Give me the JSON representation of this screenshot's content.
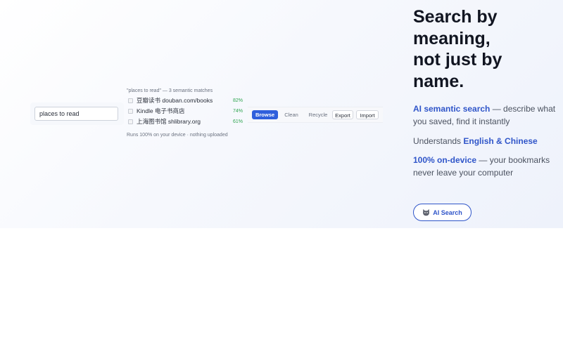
{
  "search": {
    "value": "places to read",
    "caption": "\"places to read\" — 3 semantic matches",
    "results": [
      {
        "label": "豆瓣读书 douban.com/books",
        "score": "82%"
      },
      {
        "label": "Kindle 电子书商店",
        "score": "74%"
      },
      {
        "label": "上海图书馆 shlibrary.org",
        "score": "61%"
      }
    ],
    "footer": "Runs 100% on your device · nothing uploaded"
  },
  "toolbar": {
    "browse": "Browse",
    "clean": "Clean",
    "recycle": "Recycle",
    "export": "Export",
    "import": "Import"
  },
  "hero": {
    "headline_line1": "Search by",
    "headline_line2": "meaning,",
    "headline_line3": "not just by",
    "headline_line4": "name.",
    "feature1_highlight": "AI semantic search",
    "feature1_rest": " — describe what you saved, find it instantly",
    "feature2_prefix": "Understands ",
    "feature2_highlight": "English & Chinese",
    "feature3_highlight": "100% on-device",
    "feature3_rest": " — your bookmarks never leave your computer",
    "cta_label": "AI Search",
    "cta_icon": "cat-face-icon"
  },
  "colors": {
    "accent": "#2f55c9",
    "browse_button": "#2f5fdc",
    "score": "#2ea44f"
  }
}
